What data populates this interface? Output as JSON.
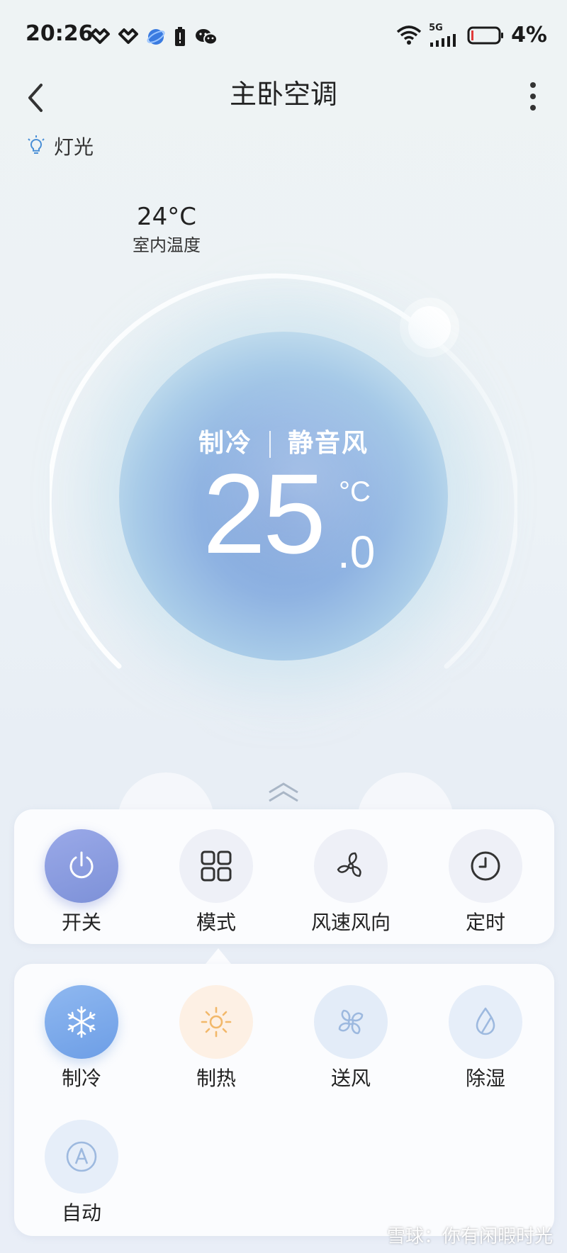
{
  "status_bar": {
    "time": "20:26",
    "network": "5G",
    "battery": "4%"
  },
  "header": {
    "title": "主卧空调"
  },
  "light": {
    "label": "灯光"
  },
  "indoor": {
    "temperature": "24°C",
    "label": "室内温度"
  },
  "dial": {
    "mode": "制冷",
    "fan": "静音风",
    "set_temp_int": "25",
    "set_temp_dec": ".0",
    "unit": "°C"
  },
  "controls": [
    {
      "label": "开关",
      "icon": "power-icon"
    },
    {
      "label": "模式",
      "icon": "grid-icon"
    },
    {
      "label": "风速风向",
      "icon": "fan-speed-icon"
    },
    {
      "label": "定时",
      "icon": "clock-icon"
    }
  ],
  "modes": [
    {
      "label": "制冷",
      "icon": "snowflake-icon",
      "selected": true
    },
    {
      "label": "制热",
      "icon": "sun-icon"
    },
    {
      "label": "送风",
      "icon": "fan-icon"
    },
    {
      "label": "除湿",
      "icon": "droplet-icon"
    },
    {
      "label": "自动",
      "icon": "auto-icon"
    }
  ],
  "watermark": "雪球：你有闲暇时光",
  "colors": {
    "accent": "#7d91d8",
    "cool": "#6d9ee6",
    "heat": "#f2b86a"
  }
}
